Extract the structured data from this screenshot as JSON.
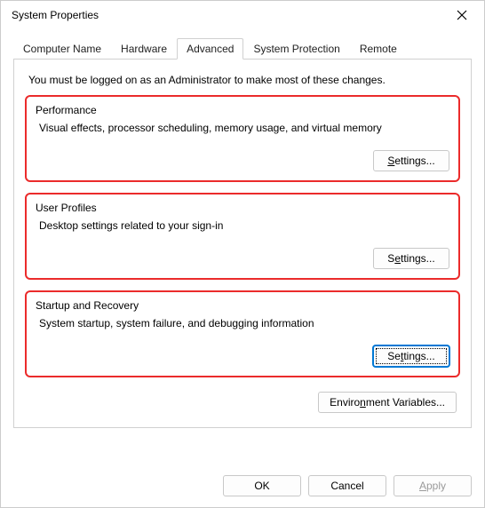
{
  "window": {
    "title": "System Properties"
  },
  "tabs": {
    "computer_name": "Computer Name",
    "hardware": "Hardware",
    "advanced": "Advanced",
    "system_protection": "System Protection",
    "remote": "Remote"
  },
  "intro": "You must be logged on as an Administrator to make most of these changes.",
  "groups": {
    "performance": {
      "title": "Performance",
      "desc": "Visual effects, processor scheduling, memory usage, and virtual memory",
      "button_prefix": "S",
      "button_rest": "ettings..."
    },
    "user_profiles": {
      "title": "User Profiles",
      "desc": "Desktop settings related to your sign-in",
      "button_prefix": "Settings...",
      "button_underline_pos": "e"
    },
    "startup": {
      "title": "Startup and Recovery",
      "desc": "System startup, system failure, and debugging information",
      "button_prefix": "Settings...",
      "button_underline_pos": "t"
    }
  },
  "env_button_prefix": "Enviro",
  "env_button_underline": "n",
  "env_button_rest": "ment Variables...",
  "footer": {
    "ok": "OK",
    "cancel": "Cancel",
    "apply_underline": "A",
    "apply_rest": "pply"
  }
}
